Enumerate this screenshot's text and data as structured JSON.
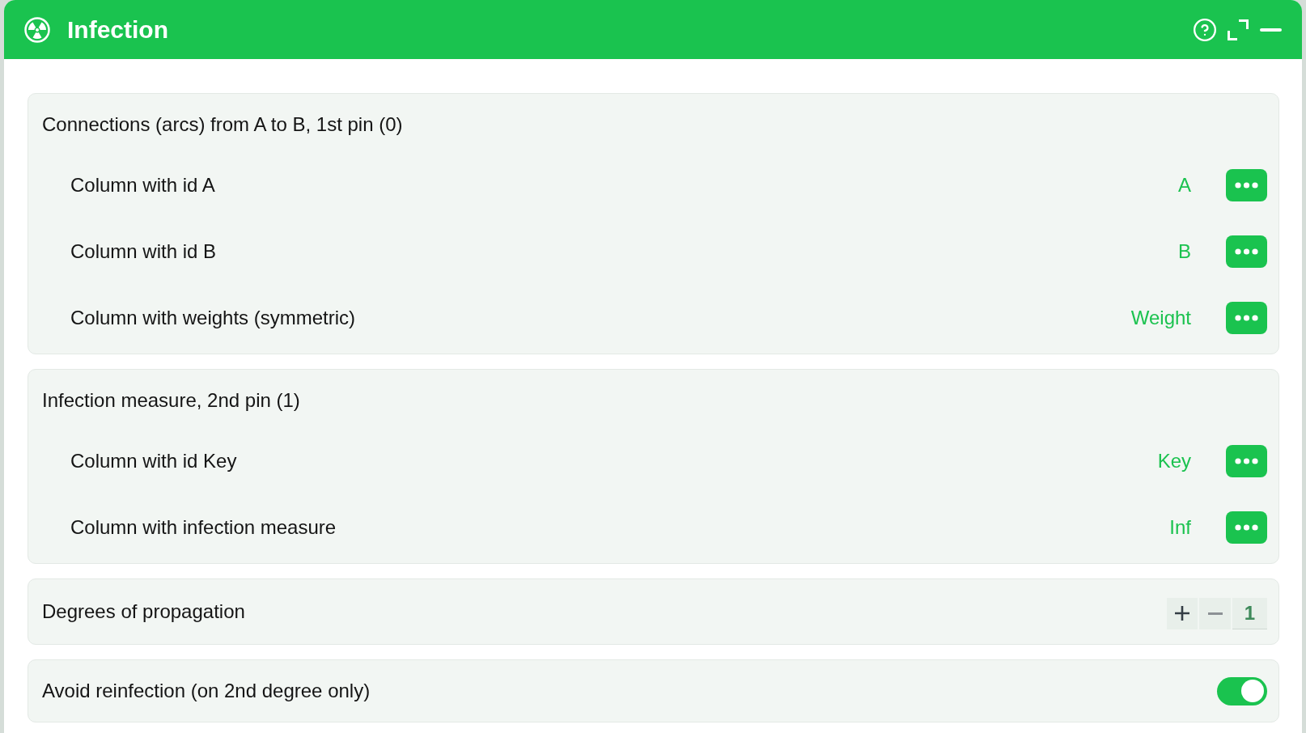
{
  "window": {
    "title": "Infection"
  },
  "sections": [
    {
      "kind": "columns",
      "title": "Connections (arcs) from A to B, 1st pin (0)",
      "rows": [
        {
          "label": "Column with id A",
          "value": "A"
        },
        {
          "label": "Column with id B",
          "value": "B"
        },
        {
          "label": "Column with weights (symmetric)",
          "value": "Weight"
        }
      ]
    },
    {
      "kind": "columns",
      "title": "Infection measure, 2nd pin (1)",
      "rows": [
        {
          "label": "Column with id Key",
          "value": "Key"
        },
        {
          "label": "Column with infection measure",
          "value": "Inf"
        }
      ]
    },
    {
      "kind": "stepper",
      "title": "Degrees of propagation",
      "value": "1",
      "increase_disabled": false,
      "decrease_disabled": true
    },
    {
      "kind": "toggle",
      "title": "Avoid reinfection (on 2nd degree only)",
      "on": true
    }
  ]
}
